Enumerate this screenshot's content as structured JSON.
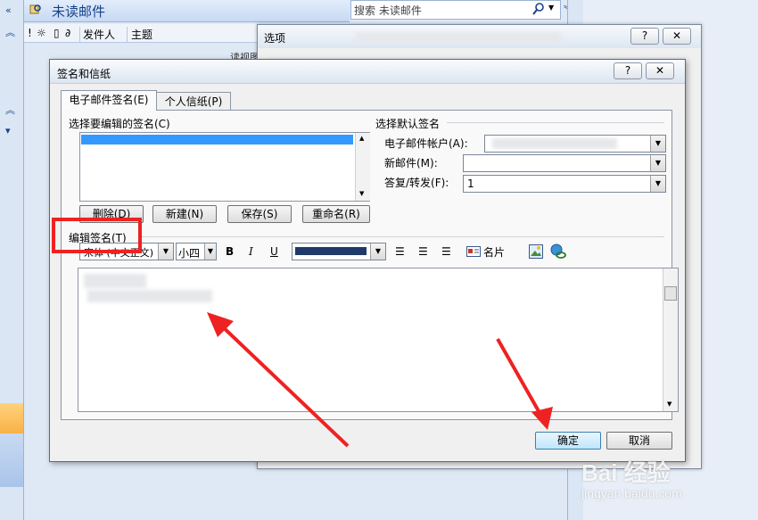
{
  "outlook": {
    "folder_title": "未读邮件",
    "search_placeholder": "搜索 未读邮件",
    "columns": {
      "from": "发件人",
      "subject": "主题"
    },
    "reading_pane_label": "读视图"
  },
  "options_dialog": {
    "title": "选项",
    "help_label": "?",
    "close_label": "✕"
  },
  "signature_dialog": {
    "title": "签名和信纸",
    "help_label": "?",
    "close_label": "✕",
    "tabs": [
      {
        "label": "电子邮件签名(E)",
        "active": true
      },
      {
        "label": "个人信纸(P)",
        "active": false
      }
    ],
    "select_signature_label": "选择要编辑的签名(C)",
    "buttons": {
      "delete": "删除(D)",
      "new": "新建(N)",
      "save": "保存(S)",
      "rename": "重命名(R)"
    },
    "default_signature": {
      "group_label": "选择默认签名",
      "account_label": "电子邮件帐户(A):",
      "new_messages_label": "新邮件(M):",
      "reply_forward_label": "答复/转发(F):",
      "reply_forward_value": "1"
    },
    "edit_signature_label": "编辑签名(T)",
    "toolbar": {
      "font": "宋体 (中文正文)",
      "size": "小四",
      "bold": "B",
      "italic": "I",
      "underline": "U",
      "business_card": "名片"
    },
    "ok": "确定",
    "cancel": "取消"
  },
  "watermark": {
    "brand": "Bai 经验",
    "url": "jingyan.baidu.com"
  },
  "colors": {
    "accent": "#15428b",
    "selection": "#3399ff",
    "font_color_swatch": "#1f3a68",
    "annotation_red": "#ee2222"
  }
}
